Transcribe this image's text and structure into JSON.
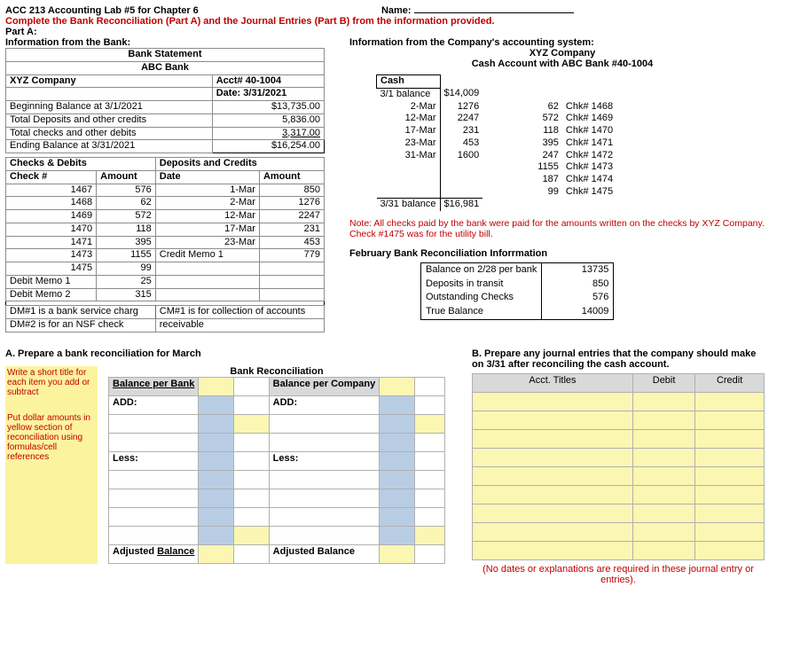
{
  "header": {
    "title": "ACC 213 Accounting Lab #5 for Chapter 6",
    "name_label": "Name:",
    "instruction": "Complete the Bank Reconciliation (Part A) and the Journal Entries (Part B) from the information provided.",
    "parta": "Part A:"
  },
  "bank_side": {
    "heading": "Information from the Bank:",
    "bank_statement": "Bank Statement",
    "bank_name": "ABC Bank",
    "company": "XYZ Company",
    "acct": "Acct# 40-1004",
    "date": "Date: 3/31/2021",
    "rows": [
      {
        "label": "Beginning Balance at 3/1/2021",
        "amount": "$13,735.00"
      },
      {
        "label": "Total Deposits and other credits",
        "amount": "5,836.00"
      },
      {
        "label": "Total checks and other debits",
        "amount": "3,317.00"
      },
      {
        "label": "Ending Balance at 3/31/2021",
        "amount": "$16,254.00"
      }
    ],
    "checks_header_l": "Checks & Debits",
    "checks_header_r": "Deposits and Credits",
    "col_checknum": "Check #",
    "col_amount": "Amount",
    "col_date": "Date",
    "col_amount2": "Amount",
    "debits": [
      {
        "num": "1467",
        "amt": "576"
      },
      {
        "num": "1468",
        "amt": "62"
      },
      {
        "num": "1469",
        "amt": "572"
      },
      {
        "num": "1470",
        "amt": "118"
      },
      {
        "num": "1471",
        "amt": "395"
      },
      {
        "num": "1473",
        "amt": "1155"
      },
      {
        "num": "1475",
        "amt": "99"
      },
      {
        "num": "Debit Memo 1",
        "amt": "25"
      },
      {
        "num": "Debit Memo 2",
        "amt": "315"
      }
    ],
    "credits": [
      {
        "date": "1-Mar",
        "amt": "850"
      },
      {
        "date": "2-Mar",
        "amt": "1276"
      },
      {
        "date": "12-Mar",
        "amt": "2247"
      },
      {
        "date": "17-Mar",
        "amt": "231"
      },
      {
        "date": "23-Mar",
        "amt": "453"
      },
      {
        "date": "Credit Memo 1",
        "amt": "779"
      }
    ],
    "note1a": "DM#1 is a bank service charg",
    "note1b": "CM#1 is for collection of accounts",
    "note2a": "DM#2 is for an NSF check",
    "note2b": "receivable"
  },
  "company_side": {
    "heading": "Information from the Company's accounting system:",
    "company": "XYZ Company",
    "cash_title": "Cash Account with ABC Bank #40-1004",
    "cash_col": "Cash",
    "open_label": "3/1 balance",
    "open_amt": "$14,009",
    "deposits": [
      {
        "d": "2-Mar",
        "a": "1276"
      },
      {
        "d": "12-Mar",
        "a": "2247"
      },
      {
        "d": "17-Mar",
        "a": "231"
      },
      {
        "d": "23-Mar",
        "a": "453"
      },
      {
        "d": "31-Mar",
        "a": "1600"
      }
    ],
    "checks": [
      {
        "a": "62",
        "c": "Chk# 1468"
      },
      {
        "a": "572",
        "c": "Chk# 1469"
      },
      {
        "a": "118",
        "c": "Chk# 1470"
      },
      {
        "a": "395",
        "c": "Chk# 1471"
      },
      {
        "a": "247",
        "c": "Chk# 1472"
      },
      {
        "a": "1155",
        "c": "Chk# 1473"
      },
      {
        "a": "187",
        "c": "Chk# 1474"
      },
      {
        "a": "99",
        "c": "Chk# 1475"
      }
    ],
    "close_label": "3/31 balance",
    "close_amt": "$16,981",
    "red_note": "Note:  All checks paid by the bank were paid for the amounts written on the checks by XYZ Company. Check #1475 was for the utility bill.",
    "feb_title": "February Bank Reconciliation Inforrmation",
    "feb": [
      {
        "l": "Balance on 2/28 per bank",
        "v": "13735"
      },
      {
        "l": "Deposits in transit",
        "v": "850"
      },
      {
        "l": "Outstanding Checks",
        "v": "576"
      },
      {
        "l": "True Balance",
        "v": "14009"
      }
    ]
  },
  "parta_rec": {
    "title": "A.  Prepare a bank reconciliation for March",
    "big_title": "Bank Reconciliation",
    "left_head": "Balance per Bank",
    "right_head": "Balance per Company",
    "add": "ADD:",
    "less": "Less:",
    "adj": "Adjusted Balance",
    "hint1": "Write a short title for each item you add or subtract",
    "hint2": "Put dollar amounts in yellow section of reconciliation using formulas/cell references"
  },
  "partb": {
    "title": "B.  Prepare any journal entries that the company should make on 3/31 after reconciling the cash account.",
    "col_titles": "Acct. Titles",
    "col_debit": "Debit",
    "col_credit": "Credit",
    "foot": "(No dates or explanations are required in these journal entry or entries)."
  }
}
